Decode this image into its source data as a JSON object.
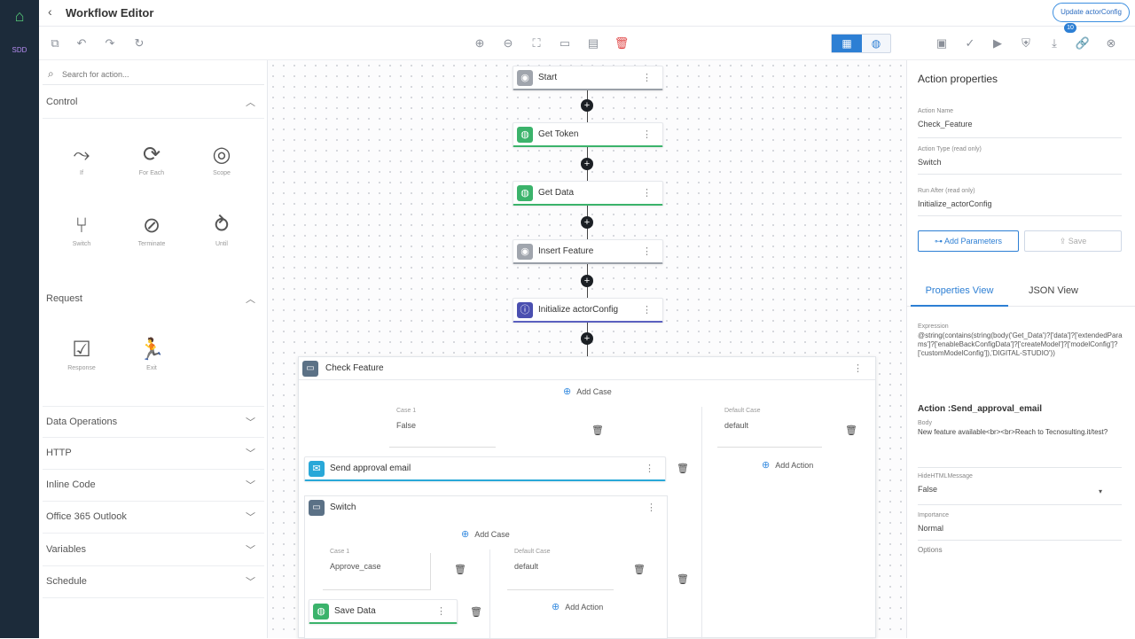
{
  "rail": {
    "tag": "SDD"
  },
  "header": {
    "title": "Workflow Editor",
    "update_button": "Update actorConfig"
  },
  "palette": {
    "search_placeholder": "Search for action...",
    "control": {
      "label": "Control",
      "tools": [
        {
          "icon": "branch-if-icon",
          "glyph": "⤳",
          "label": "If"
        },
        {
          "icon": "loop-icon",
          "glyph": "⟳",
          "label": "For Each"
        },
        {
          "icon": "scope-icon",
          "glyph": "◎",
          "label": "Scope"
        },
        {
          "icon": "switch-icon",
          "glyph": "⑂",
          "label": "Switch"
        },
        {
          "icon": "terminate-icon",
          "glyph": "⊘",
          "label": "Terminate"
        },
        {
          "icon": "until-icon",
          "glyph": "⥁",
          "label": "Until"
        }
      ]
    },
    "request": {
      "label": "Request",
      "tools": [
        {
          "icon": "response-icon",
          "glyph": "☑",
          "label": "Response"
        },
        {
          "icon": "exit-icon",
          "glyph": "🏃",
          "label": "Exit"
        }
      ]
    },
    "sections": [
      "Data Operations",
      "HTTP",
      "Inline Code",
      "Office 365 Outlook",
      "Variables",
      "Schedule"
    ]
  },
  "canvas": {
    "nodes": [
      "Start",
      "Get Token",
      "Get Data",
      "Insert Feature",
      "Initialize actorConfig"
    ],
    "check": {
      "title": "Check Feature",
      "add_case": "Add Case",
      "case1_label": "Case 1",
      "case1_value": "False",
      "default_label": "Default Case",
      "default_value": "default",
      "add_action": "Add Action",
      "send_email": "Send approval email",
      "inner_switch": "Switch",
      "inner_add_case": "Add Case",
      "inner_case_label": "Case 1",
      "inner_case_value": "Approve_case",
      "inner_default_label": "Default Case",
      "inner_default_value": "default",
      "inner_add_action": "Add Action",
      "save_data": "Save Data"
    }
  },
  "props": {
    "title": "Action properties",
    "action_name_label": "Action Name",
    "action_name": "Check_Feature",
    "action_type_label": "Action Type (read only)",
    "action_type": "Switch",
    "run_after_label": "Run After (read only)",
    "run_after": "Initialize_actorConfig",
    "add_param": "Add Parameters",
    "save": "Save",
    "tab_properties": "Properties View",
    "tab_json": "JSON View",
    "expression_label": "Expression",
    "expression": "@string(contains(string(body('Get_Data')?['data']?['extendedParams']?['enableBackConfigData']?['createModel']?['modelConfig']?['customModelConfig']),'DIGITAL-STUDIO'))",
    "action_send": "Action :Send_approval_email",
    "body_label": "Body",
    "body_value": "New feature available<br><br>Reach to Tecnosulting.it/test?",
    "html_label": "HideHTMLMessage",
    "html_value": "False",
    "importance_label": "Importance",
    "importance_value": "Normal",
    "options_label": "Options"
  }
}
